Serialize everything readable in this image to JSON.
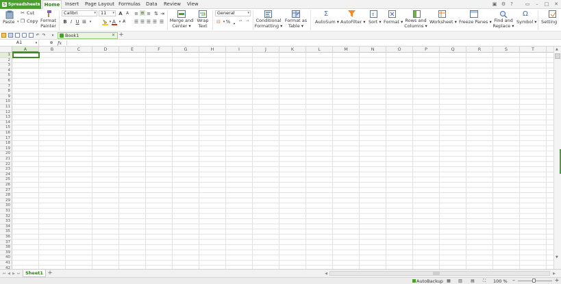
{
  "app": {
    "name": "Spreadsheets",
    "logo_letter": "S"
  },
  "menu_tabs": [
    "Home",
    "Insert",
    "Page Layout",
    "Formulas",
    "Data",
    "Review",
    "View"
  ],
  "ribbon": {
    "paste": "Paste",
    "cut": "Cut",
    "copy": "Copy",
    "format_painter": [
      "Format",
      "Painter"
    ],
    "font_name": "Calibri",
    "font_size": "11",
    "bold": "B",
    "italic": "I",
    "underline": "U",
    "grow": "A",
    "shrink": "A",
    "number_format": "General",
    "percent": "%",
    "merge_center": [
      "Merge and",
      "Center"
    ],
    "wrap_text": [
      "Wrap",
      "Text"
    ],
    "conditional_formatting": [
      "Conditional",
      "Formatting"
    ],
    "format_as_table": [
      "Format as",
      "Table"
    ],
    "autosum": "AutoSum",
    "autofilter": "AutoFilter",
    "sort": "Sort",
    "format": "Format",
    "rows_columns": [
      "Rows and",
      "Columns"
    ],
    "worksheet": "Worksheet",
    "freeze_panes": "Freeze Panes",
    "find_replace": [
      "Find and",
      "Replace"
    ],
    "symbol": "Symbol",
    "settings": "Setting"
  },
  "document_tab": "Book1",
  "name_box": "A1",
  "fx_label": "fx",
  "columns": [
    "A",
    "B",
    "C",
    "D",
    "E",
    "F",
    "G",
    "H",
    "I",
    "J",
    "K",
    "L",
    "M",
    "N",
    "O",
    "P",
    "Q",
    "R",
    "S",
    "T"
  ],
  "rows": [
    "1",
    "2",
    "3",
    "4",
    "5",
    "6",
    "7",
    "8",
    "9",
    "10",
    "11",
    "12",
    "13",
    "14",
    "15",
    "16",
    "17",
    "18",
    "19",
    "20",
    "21",
    "22",
    "23",
    "24",
    "25",
    "26",
    "27",
    "28",
    "29",
    "30",
    "31",
    "32",
    "33",
    "34",
    "35",
    "36",
    "37",
    "38",
    "39",
    "40",
    "41",
    "42"
  ],
  "sheet_tab": "Sheet1",
  "status": {
    "autobackup": "AutoBackup",
    "zoom": "100 %"
  },
  "colors": {
    "accent": "#4a9e2f",
    "selection": "#3d8a25"
  }
}
